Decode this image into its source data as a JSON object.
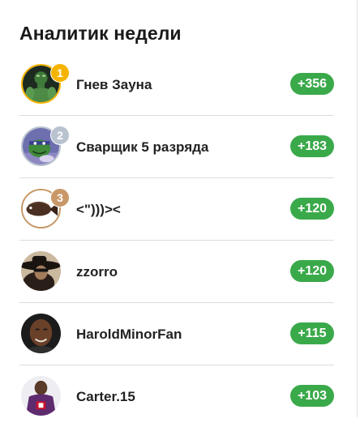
{
  "widget": {
    "title": "Аналитик недели",
    "users": [
      {
        "rank": "1",
        "name": "Гнев Зауна",
        "score": "+356",
        "avatar": "hulk-avatar"
      },
      {
        "rank": "2",
        "name": "Сварщик 5 разряда",
        "score": "+183",
        "avatar": "turtle-avatar"
      },
      {
        "rank": "3",
        "name": "<\")))><",
        "score": "+120",
        "avatar": "fish-avatar"
      },
      {
        "rank": "",
        "name": "zzorro",
        "score": "+120",
        "avatar": "zorro-avatar"
      },
      {
        "rank": "",
        "name": "HaroldMinorFan",
        "score": "+115",
        "avatar": "basketball-player-avatar"
      },
      {
        "rank": "",
        "name": "Carter.15",
        "score": "+103",
        "avatar": "raptors-player-avatar"
      }
    ]
  },
  "colors": {
    "gold": "#f5b400",
    "silver": "#b9c3cf",
    "bronze": "#c89868",
    "score_badge": "#3aa94a"
  }
}
